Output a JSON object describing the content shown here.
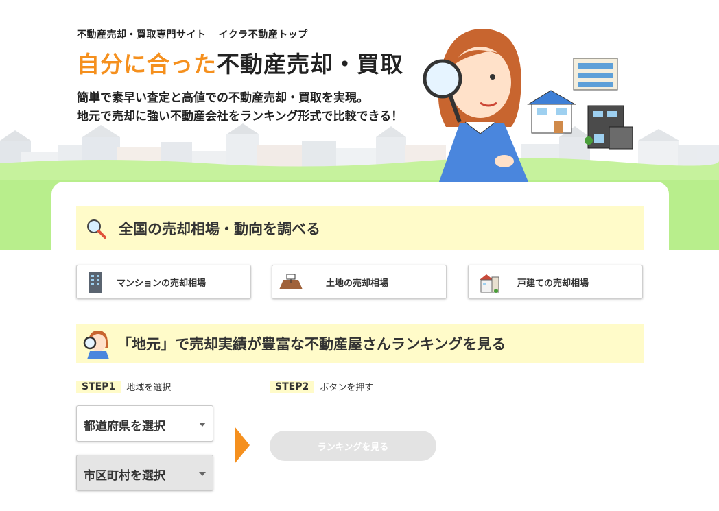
{
  "hero": {
    "site_name": "不動産売却・買取専門サイト",
    "brand": "イクラ不動産トップ",
    "catch_accent": "自分に合った",
    "catch_main": "不動産売却・買取",
    "lead_line1": "簡単で素早い査定と高値での不動産売却・買取を実現。",
    "lead_line2": "地元で売却に強い不動産会社をランキング形式で比較できる！"
  },
  "market": {
    "title": "全国の売却相場・動向を調べる",
    "buttons": [
      {
        "label": "マンションの売却相場",
        "icon": "apartment-icon"
      },
      {
        "label": "土地の売却相場",
        "icon": "land-icon"
      },
      {
        "label": "戸建ての売却相場",
        "icon": "house-icon"
      }
    ]
  },
  "ranking": {
    "title": "「地元」で売却実績が豊富な不動産屋さんランキングを見る",
    "step1_badge": "STEP1",
    "step1_text": "地域を選択",
    "step2_badge": "STEP2",
    "step2_text": "ボタンを押す",
    "prefecture_value": "都道府県を選択",
    "city_value": "市区町村を選択",
    "view_button": "ランキングを見る"
  },
  "colors": {
    "accent": "#f5901e",
    "section_bg": "#fffbc9",
    "hero_green": "#b8ee8c"
  }
}
